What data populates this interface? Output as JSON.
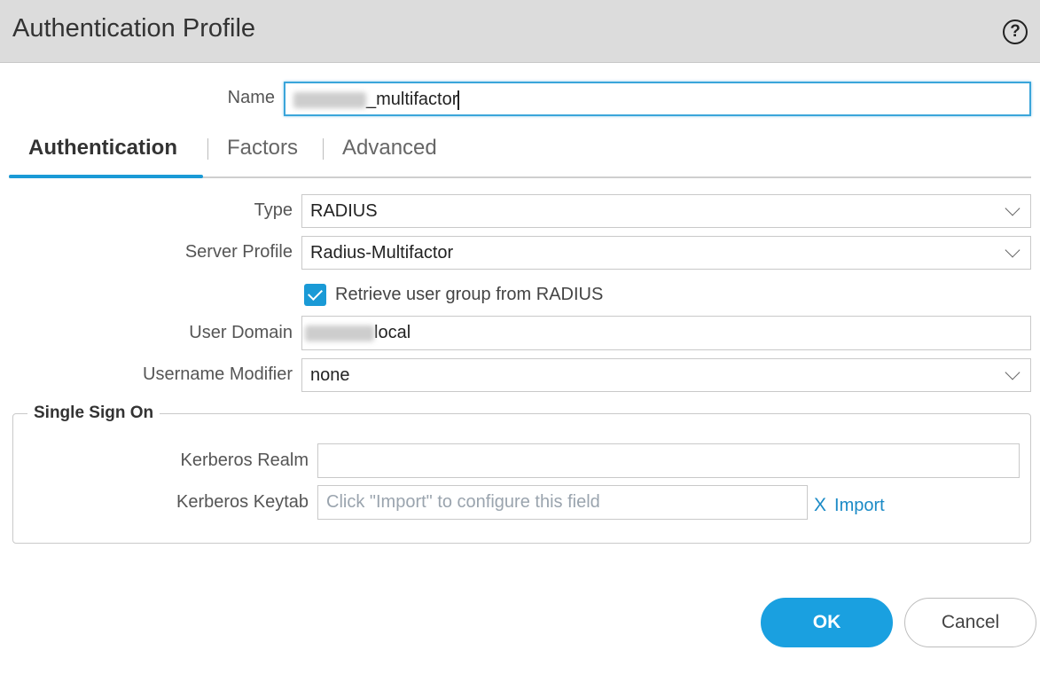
{
  "dialog": {
    "title": "Authentication Profile",
    "help_icon": "help-circle-icon",
    "help_glyph": "?"
  },
  "name": {
    "label": "Name",
    "value_suffix": "_multifactor"
  },
  "tabs": [
    {
      "label": "Authentication",
      "active": true
    },
    {
      "label": "Factors",
      "active": false
    },
    {
      "label": "Advanced",
      "active": false
    }
  ],
  "form": {
    "type": {
      "label": "Type",
      "value": "RADIUS"
    },
    "server_profile": {
      "label": "Server Profile",
      "value": "Radius-Multifactor"
    },
    "retrieve_group": {
      "label": "Retrieve user group from RADIUS",
      "checked": true
    },
    "user_domain": {
      "label": "User Domain",
      "value_suffix": "local"
    },
    "username_modifier": {
      "label": "Username Modifier",
      "value": "none"
    }
  },
  "sso": {
    "legend": "Single Sign On",
    "kerberos_realm": {
      "label": "Kerberos Realm",
      "value": ""
    },
    "kerberos_keytab": {
      "label": "Kerberos Keytab",
      "placeholder": "Click \"Import\" to configure this field"
    },
    "clear_glyph": "X",
    "import_label": "Import"
  },
  "buttons": {
    "ok": "OK",
    "cancel": "Cancel"
  },
  "colors": {
    "accent": "#1a9ad6",
    "ok_button": "#1aa0e0",
    "titlebar": "#dcdcdc",
    "link": "#1a8ac6"
  }
}
